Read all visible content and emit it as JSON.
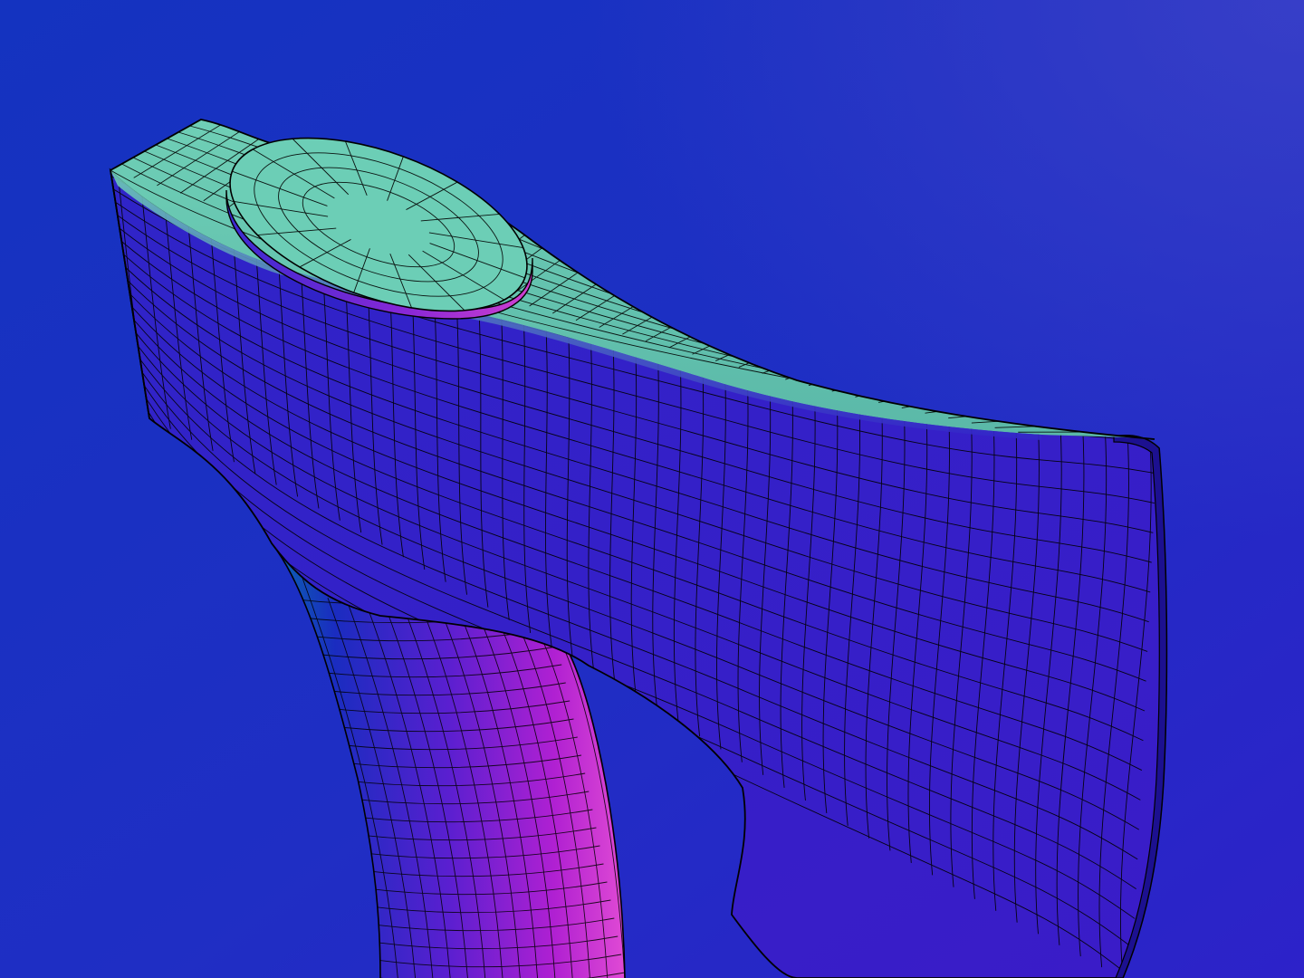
{
  "scene": {
    "subject": "",
    "render_style": "normal-map shading with wireframe overlay",
    "colors": {
      "background_top_left": "#1530c0",
      "background_bottom_right": "#2a22c8",
      "background_top_right": "#3a3fc8",
      "head_top_face": "#6ccab4",
      "head_side_face": "#3320c8",
      "handle_shadow_side": "#0e4fa8",
      "handle_lit_side": "#c81ed0",
      "wire": "#000000"
    }
  }
}
